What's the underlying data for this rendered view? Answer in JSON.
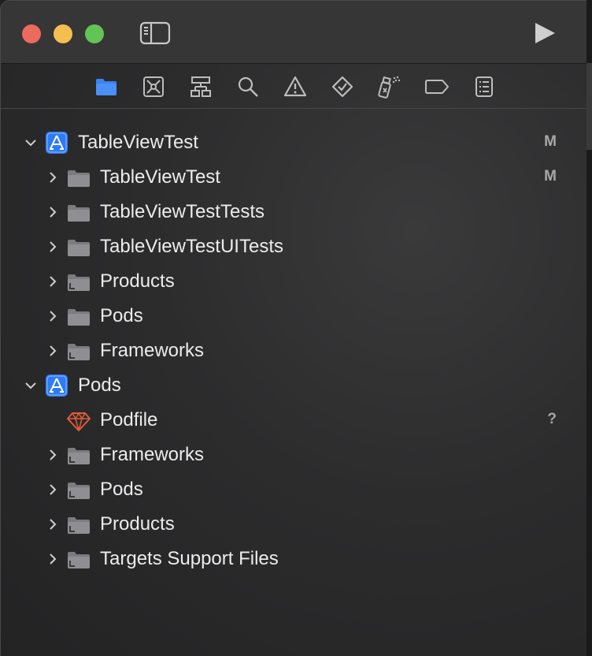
{
  "toolbar": {
    "run_icon": "play-icon",
    "sidebar_icon": "sidebar-icon"
  },
  "navigator_tabs": [
    {
      "name": "project-navigator",
      "icon": "folder-icon",
      "active": true
    },
    {
      "name": "source-control-navigator",
      "icon": "source-control-icon"
    },
    {
      "name": "symbol-navigator",
      "icon": "hierarchy-icon"
    },
    {
      "name": "find-navigator",
      "icon": "magnifier-icon"
    },
    {
      "name": "issue-navigator",
      "icon": "warning-icon"
    },
    {
      "name": "test-navigator",
      "icon": "diamond-check-icon"
    },
    {
      "name": "debug-navigator",
      "icon": "spray-icon"
    },
    {
      "name": "breakpoint-navigator",
      "icon": "tag-icon"
    },
    {
      "name": "report-navigator",
      "icon": "list-icon"
    }
  ],
  "colors": {
    "accent": "#3b82f6",
    "folder": "#8f8f93",
    "project_icon": "#2f7bf6",
    "podfile_icon": "#e05a3a",
    "badge": "#a8a8a8"
  },
  "tree": [
    {
      "label": "TableViewTest",
      "level": 0,
      "expanded": true,
      "icon": "project",
      "badge": "M"
    },
    {
      "label": "TableViewTest",
      "level": 1,
      "expanded": false,
      "icon": "folder",
      "badge": "M"
    },
    {
      "label": "TableViewTestTests",
      "level": 1,
      "expanded": false,
      "icon": "folder",
      "badge": ""
    },
    {
      "label": "TableViewTestUITests",
      "level": 1,
      "expanded": false,
      "icon": "folder",
      "badge": ""
    },
    {
      "label": "Products",
      "level": 1,
      "expanded": false,
      "icon": "group",
      "badge": ""
    },
    {
      "label": "Pods",
      "level": 1,
      "expanded": false,
      "icon": "folder",
      "badge": ""
    },
    {
      "label": "Frameworks",
      "level": 1,
      "expanded": false,
      "icon": "group",
      "badge": ""
    },
    {
      "label": "Pods",
      "level": 0,
      "expanded": true,
      "icon": "project",
      "badge": ""
    },
    {
      "label": "Podfile",
      "level": 1,
      "expanded": null,
      "icon": "ruby",
      "badge": "?"
    },
    {
      "label": "Frameworks",
      "level": 1,
      "expanded": false,
      "icon": "group",
      "badge": ""
    },
    {
      "label": "Pods",
      "level": 1,
      "expanded": false,
      "icon": "group",
      "badge": ""
    },
    {
      "label": "Products",
      "level": 1,
      "expanded": false,
      "icon": "group",
      "badge": ""
    },
    {
      "label": "Targets Support Files",
      "level": 1,
      "expanded": false,
      "icon": "group",
      "badge": ""
    }
  ]
}
